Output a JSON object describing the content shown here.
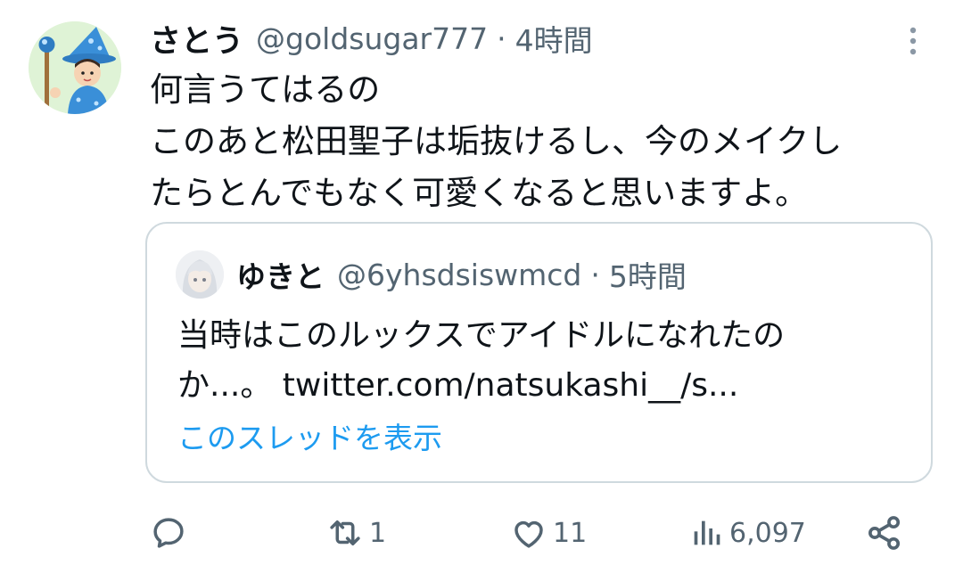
{
  "tweet": {
    "display_name": "さとう",
    "handle": "@goldsugar777",
    "separator": "·",
    "time": "4時間",
    "text": "何言うてはるの\nこのあと松田聖子は垢抜けるし、今のメイクし\nたらとんでもなく可愛くなると思いますよ。"
  },
  "quote": {
    "display_name": "ゆきと",
    "handle": "@6yhsdsiswmcd",
    "separator": "·",
    "time": "5時間",
    "text": "当時はこのルックスでアイドルになれたの\nか...。 twitter.com/natsukashi__/s...",
    "thread_link": "このスレッドを表示"
  },
  "actions": {
    "reply_count": "",
    "retweet_count": "1",
    "like_count": "11",
    "views_count": "6,097"
  },
  "icons": [
    "more-icon",
    "reply-icon",
    "retweet-icon",
    "like-icon",
    "views-icon",
    "share-icon"
  ],
  "colors": {
    "text": "#0f1419",
    "secondary": "#536471",
    "link": "#1d9bf0",
    "border": "#cfd9de"
  }
}
